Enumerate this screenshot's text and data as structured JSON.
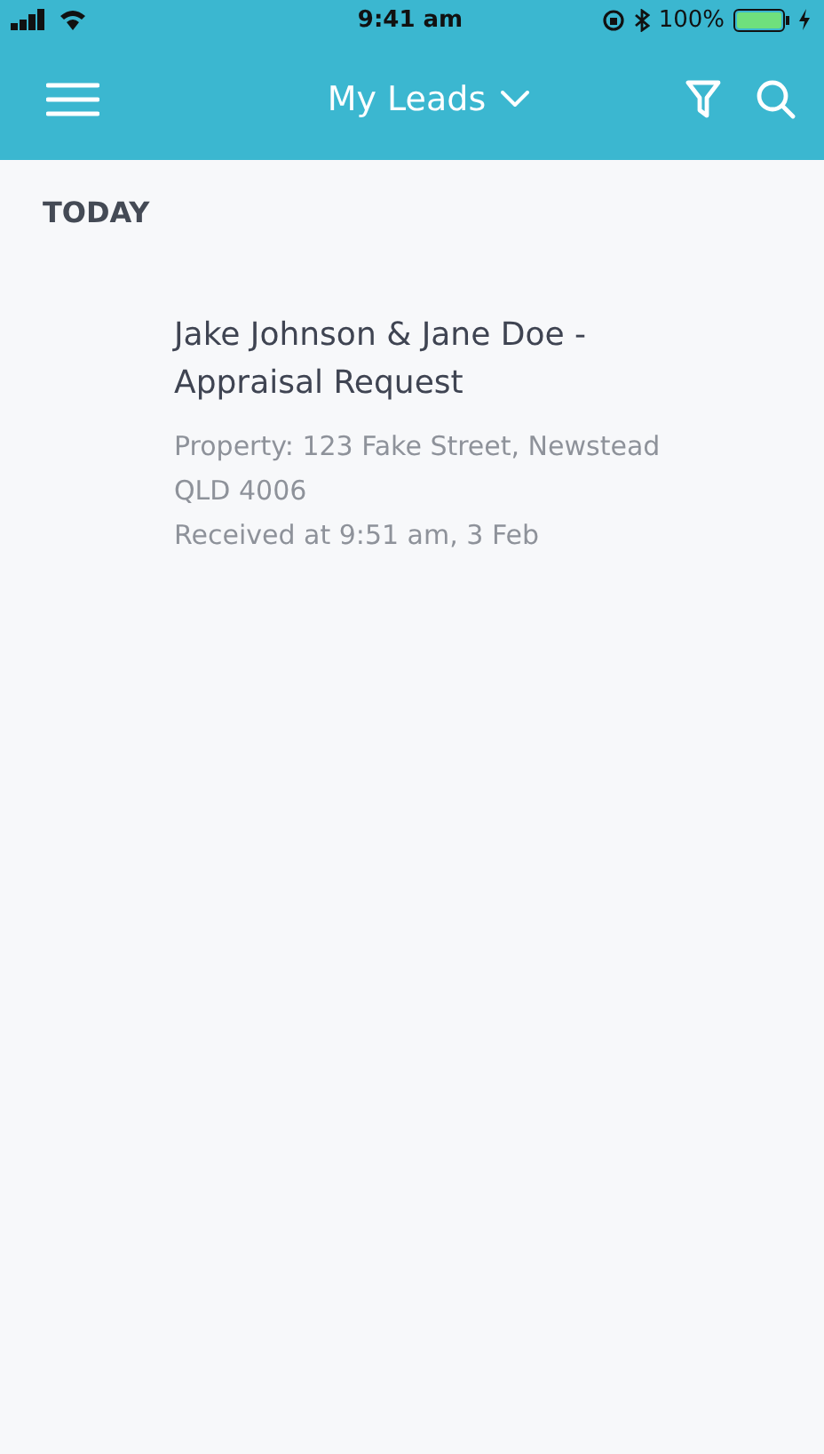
{
  "status_bar": {
    "time": "9:41 am",
    "battery": "100%"
  },
  "header": {
    "title": "My Leads"
  },
  "sections": [
    {
      "heading": "TODAY",
      "leads": [
        {
          "title": "Jake Johnson & Jane Doe - Appraisal Request",
          "property": "Property: 123 Fake Street, Newstead QLD 4006",
          "received": "Received at 9:51 am, 3 Feb"
        }
      ]
    }
  ]
}
